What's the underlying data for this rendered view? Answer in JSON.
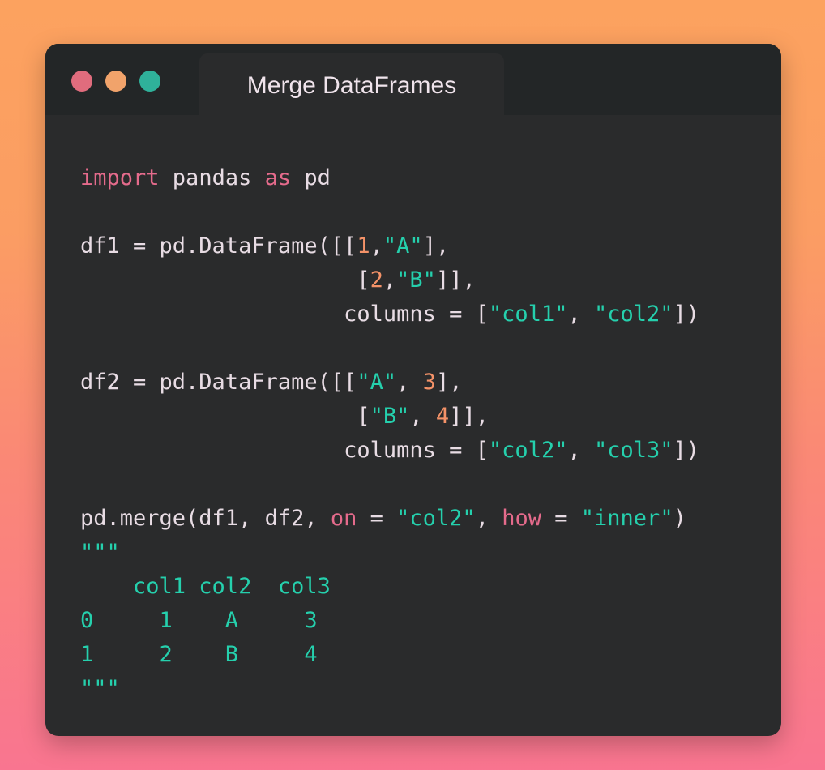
{
  "window": {
    "tab_title": "Merge DataFrames",
    "buttons": [
      "close-button",
      "minimize-button",
      "maximize-button"
    ]
  },
  "code": {
    "line1": [
      "import",
      " pandas ",
      "as",
      " pd"
    ],
    "line3": [
      "df1 = pd.DataFrame([[",
      "1",
      ",",
      "\"A\"",
      "],"
    ],
    "line4": [
      "                     [",
      "2",
      ",",
      "\"B\"",
      "]],"
    ],
    "line5": [
      "                    columns = [",
      "\"col1\"",
      ", ",
      "\"col2\"",
      "])"
    ],
    "line7": [
      "df2 = pd.DataFrame([[",
      "\"A\"",
      ", ",
      "3",
      "],"
    ],
    "line8": [
      "                     [",
      "\"B\"",
      ", ",
      "4",
      "]],"
    ],
    "line9": [
      "                    columns = [",
      "\"col2\"",
      ", ",
      "\"col3\"",
      "])"
    ],
    "line11": [
      "pd.merge(df1, df2, ",
      "on",
      " = ",
      "\"col2\"",
      ", ",
      "how",
      " = ",
      "\"inner\"",
      ")"
    ],
    "output": [
      "\"\"\"",
      "    col1 col2  col3",
      "0     1    A     3",
      "1     2    B     4",
      "\"\"\""
    ]
  },
  "colors": {
    "keyword": "#e56b8c",
    "number": "#f49268",
    "string": "#25d0ad",
    "text": "#e8dce4",
    "window_bg": "#2a2b2c",
    "titlebar_bg": "#232627"
  }
}
